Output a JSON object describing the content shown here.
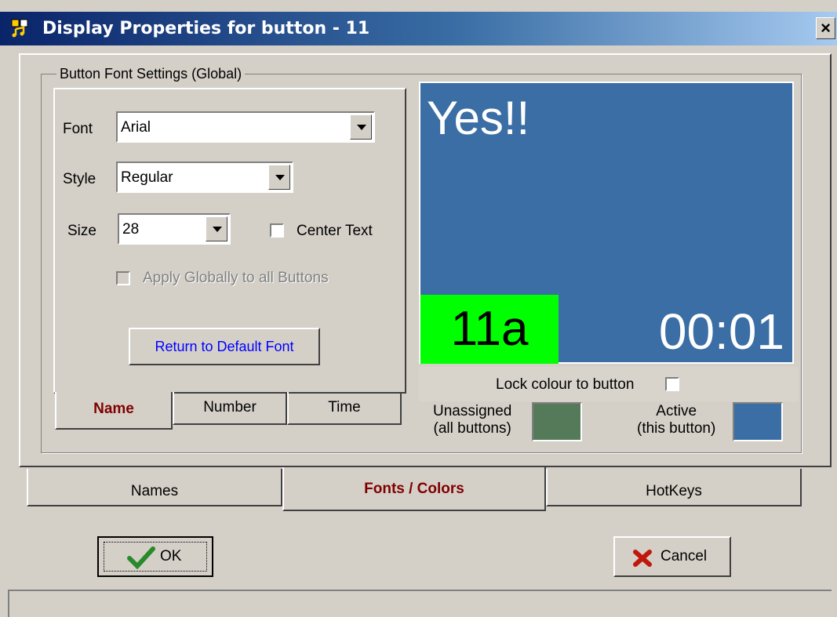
{
  "window": {
    "title": "Display Properties for button - 11",
    "close_label": "×"
  },
  "group": {
    "label": "Button Font Settings (Global)"
  },
  "font": {
    "label": "Font",
    "value": "Arial"
  },
  "style": {
    "label": "Style",
    "value": "Regular"
  },
  "size": {
    "label": "Size",
    "value": "28"
  },
  "center_text": {
    "label": "Center Text",
    "checked": false
  },
  "apply_globally": {
    "label": "Apply Globally to all Buttons",
    "checked": false,
    "disabled": true
  },
  "return_default_label": "Return to Default Font",
  "inner_tabs": [
    {
      "label": "Name",
      "active": true
    },
    {
      "label": "Number",
      "active": false
    },
    {
      "label": "Time",
      "active": false
    }
  ],
  "preview": {
    "name": "Yes!!",
    "number": "11a",
    "time": "00:01",
    "bg_color": "#3a6ea5",
    "number_color": "#00ff00"
  },
  "lock_colour": {
    "label": "Lock colour to button",
    "checked": false
  },
  "unassigned": {
    "line1": "Unassigned",
    "line2": "(all buttons)",
    "color": "#557a5a"
  },
  "active_color": {
    "line1": "Active",
    "line2": "(this button)",
    "color": "#3a6ea5"
  },
  "main_tabs": [
    {
      "label": "Names",
      "active": false
    },
    {
      "label": "Fonts / Colors",
      "active": true
    },
    {
      "label": "HotKeys",
      "active": false
    }
  ],
  "ok_label": "OK",
  "cancel_label": "Cancel",
  "colors": {
    "active_tab_text": "#800000",
    "link_text": "#0000ff"
  }
}
